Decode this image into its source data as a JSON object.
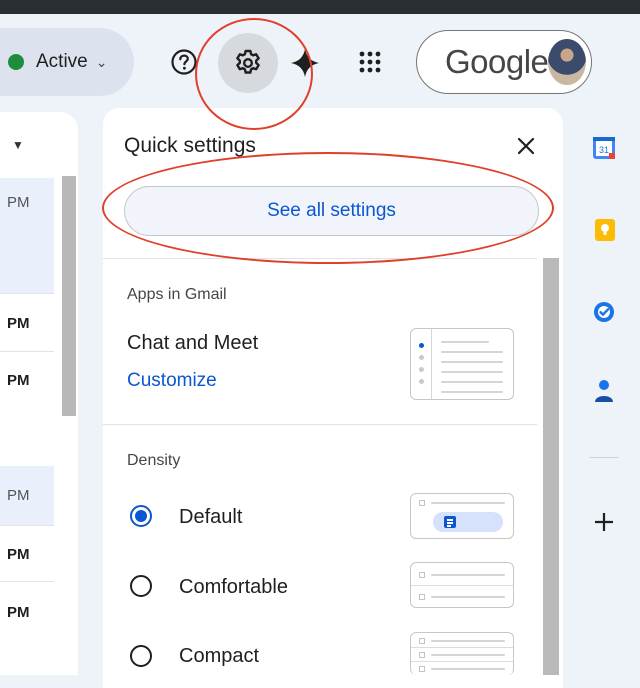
{
  "header": {
    "status_label": "Active",
    "account_wordmark": "Google",
    "icons": [
      "help-icon",
      "gear-icon",
      "gemini-spark-icon",
      "apps-grid-icon",
      "avatar"
    ]
  },
  "mail_list": {
    "rows": [
      {
        "time": "PM",
        "weight": "light"
      },
      {
        "time": "PM",
        "weight": "bold"
      },
      {
        "time": "PM",
        "weight": "bold"
      },
      {
        "time": "PM",
        "weight": "light"
      },
      {
        "time": "PM",
        "weight": "bold"
      },
      {
        "time": "PM",
        "weight": "bold"
      }
    ]
  },
  "quick_settings": {
    "title": "Quick settings",
    "see_all_label": "See all settings",
    "apps_section": "Apps in Gmail",
    "chat_label": "Chat and Meet",
    "customize_label": "Customize",
    "density_section": "Density",
    "density_options": [
      {
        "label": "Default",
        "selected": true
      },
      {
        "label": "Comfortable",
        "selected": false
      },
      {
        "label": "Compact",
        "selected": false
      }
    ]
  },
  "side_apps": [
    "calendar-icon",
    "keep-icon",
    "tasks-icon",
    "contacts-icon",
    "add-icon"
  ],
  "colors": {
    "accent": "#0b57d0",
    "annotation": "#e0402a",
    "status_green": "#1e8e3e"
  }
}
